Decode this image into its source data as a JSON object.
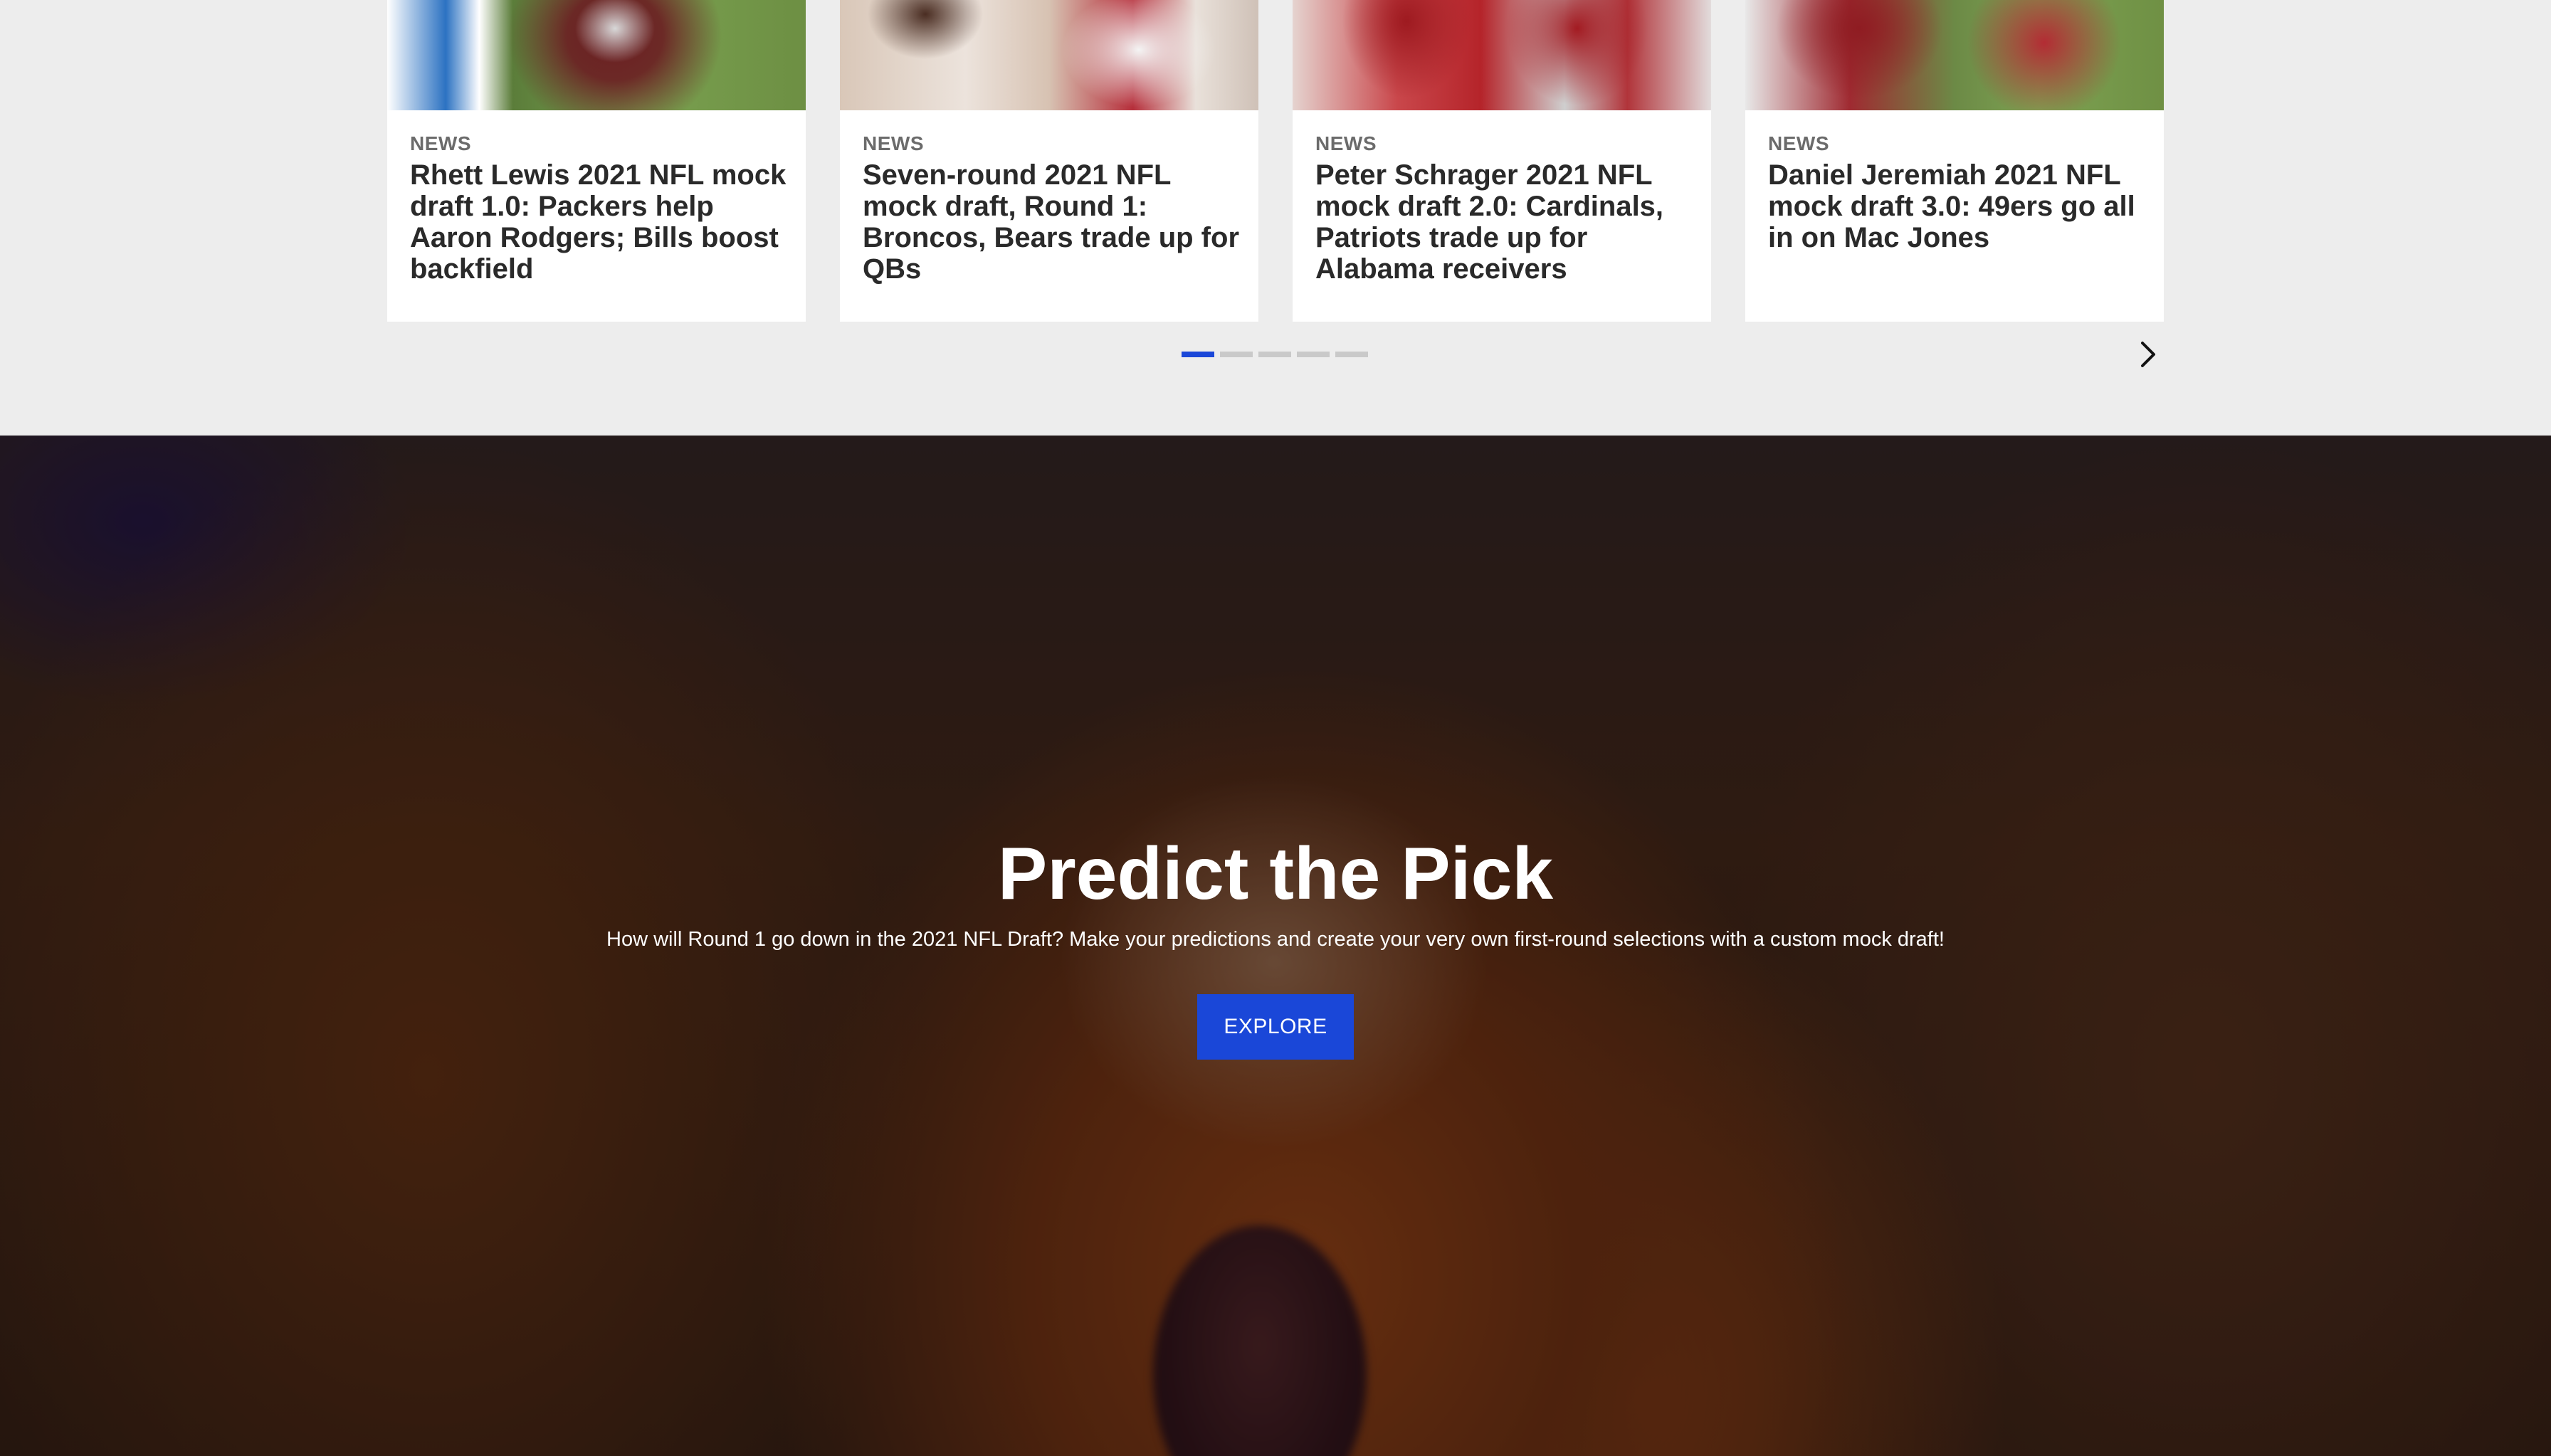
{
  "carousel": {
    "cards": [
      {
        "kicker": "NEWS",
        "title": "Rhett Lewis 2021 NFL mock draft 1.0: Packers help Aaron Rodgers; Bills boost backfield"
      },
      {
        "kicker": "NEWS",
        "title": "Seven-round 2021 NFL mock draft, Round 1: Broncos, Bears trade up for QBs"
      },
      {
        "kicker": "NEWS",
        "title": "Peter Schrager 2021 NFL mock draft 2.0: Cardinals, Patriots trade up for Alabama receivers"
      },
      {
        "kicker": "NEWS",
        "title": "Daniel Jeremiah 2021 NFL mock draft 3.0: 49ers go all in on Mac Jones"
      }
    ],
    "pagination": {
      "total": 5,
      "active_index": 0
    },
    "next_icon": "chevron-right-icon",
    "accent_color": "#1a47d8"
  },
  "hero": {
    "title": "Predict the Pick",
    "description": "How will Round 1 go down in the 2021 NFL Draft? Make your predictions and create your very own first-round selections with a custom mock draft!",
    "button_label": "EXPLORE",
    "button_color": "#1a47d8"
  }
}
